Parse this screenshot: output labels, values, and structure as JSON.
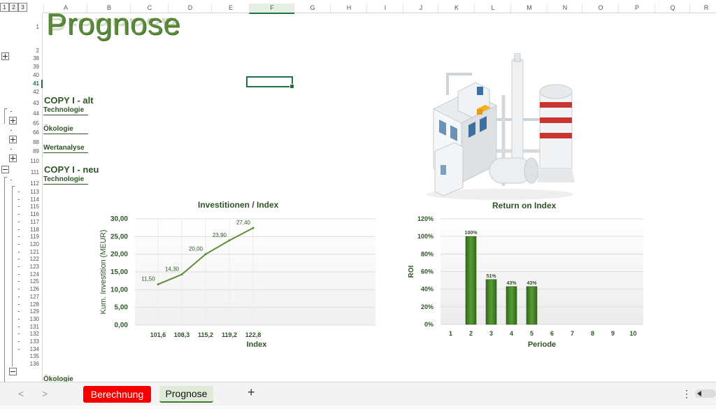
{
  "outline_levels": [
    "1",
    "2",
    "3"
  ],
  "columns": [
    {
      "id": "A",
      "w": 62
    },
    {
      "id": "B",
      "w": 62
    },
    {
      "id": "C",
      "w": 54
    },
    {
      "id": "D",
      "w": 62
    },
    {
      "id": "E",
      "w": 54
    },
    {
      "id": "F",
      "w": 64,
      "sel": true
    },
    {
      "id": "G",
      "w": 52
    },
    {
      "id": "H",
      "w": 52
    },
    {
      "id": "I",
      "w": 52
    },
    {
      "id": "J",
      "w": 50
    },
    {
      "id": "K",
      "w": 52
    },
    {
      "id": "L",
      "w": 52
    },
    {
      "id": "M",
      "w": 52
    },
    {
      "id": "N",
      "w": 50
    },
    {
      "id": "O",
      "w": 52
    },
    {
      "id": "P",
      "w": 52
    },
    {
      "id": "Q",
      "w": 50
    },
    {
      "id": "R",
      "w": 46
    }
  ],
  "rows": {
    "top": [
      "1",
      "2",
      "38",
      "39",
      "40",
      "41",
      "42",
      "43",
      "44",
      "65",
      "66",
      "88",
      "89",
      "110",
      "111",
      "112"
    ],
    "dense": [
      "113",
      "114",
      "115",
      "116",
      "117",
      "118",
      "119",
      "120",
      "121",
      "122",
      "123",
      "124",
      "125",
      "126",
      "127",
      "128",
      "129",
      "130",
      "131",
      "132",
      "133",
      "134",
      "135",
      "136"
    ],
    "selected": "41"
  },
  "sheet": {
    "title": "Prognose",
    "section_alt": "COPY I - alt",
    "section_neu": "COPY I - neu",
    "items_alt": [
      "Technologie",
      "Ökologie",
      "Wertanalyse"
    ],
    "item_neu": "Technologie",
    "item_bottom": "Ökologie"
  },
  "chart_data": [
    {
      "type": "line",
      "title": "Investitionen / Index",
      "xlabel": "Index",
      "ylabel": "Kum. Investition (MEUR)",
      "categories": [
        "101,6",
        "108,3",
        "115,2",
        "119,2",
        "122,8"
      ],
      "values": [
        11.5,
        14.3,
        20.0,
        23.9,
        27.4
      ],
      "data_labels": [
        "11,50",
        "14,30",
        "20,00",
        "23,90",
        "27,40"
      ],
      "yticks": [
        "0,00",
        "5,00",
        "10,00",
        "15,00",
        "20,00",
        "25,00",
        "30,00"
      ],
      "ylim": [
        0,
        30
      ],
      "color": "#5e8c3a",
      "grid": true
    },
    {
      "type": "bar",
      "title": "Return on Index",
      "xlabel": "Periode",
      "ylabel": "ROI",
      "categories": [
        "1",
        "2",
        "3",
        "4",
        "5",
        "6",
        "7",
        "8",
        "9",
        "10"
      ],
      "values": [
        null,
        100,
        51,
        43,
        43,
        null,
        null,
        null,
        null,
        null
      ],
      "data_labels": [
        "",
        "100%",
        "51%",
        "43%",
        "43%",
        "",
        "",
        "",
        "",
        ""
      ],
      "yticks": [
        "0%",
        "20%",
        "40%",
        "60%",
        "80%",
        "100%",
        "120%"
      ],
      "ylim": [
        0,
        120
      ],
      "color": "#3f7a23",
      "grid": true
    }
  ],
  "tabs": {
    "berechnung": "Berechnung",
    "prognose": "Prognose",
    "add": "+",
    "prev": "<",
    "next": ">",
    "menu": "⋮"
  },
  "colors": {
    "accent": "#217346",
    "tab_red": "#f40000",
    "tab_active_bg": "#dfead9",
    "section_green": "#2f5427"
  }
}
